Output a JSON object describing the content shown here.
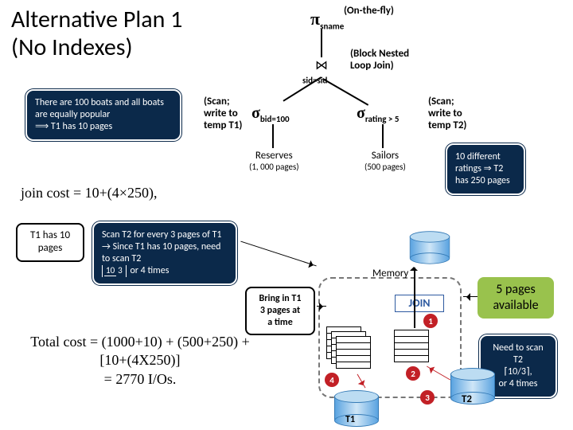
{
  "title": "Alternative Plan 1\n(No Indexes)",
  "tree": {
    "pi_sym": "π",
    "pi_sub": "sname",
    "pi_annot": "(On-the-fly)",
    "join_sub": "sid=sid",
    "join_annot": "(Block Nested\nLoop Join)",
    "left_sigma_sub": "bid=100",
    "left_sigma_annot": "(Scan;\nwrite to\ntemp T1)",
    "right_sigma_sub": "rating > 5",
    "right_sigma_annot": "(Scan;\nwrite to\ntemp T2)",
    "reserves": "Reserves",
    "reserves_pages": "(1, 000 pages)",
    "sailors": "Sailors",
    "sailors_pages": "(500 pages)"
  },
  "callouts": {
    "boats": "There are 100 boats and all boats are equally popular\n⟹ T1 has 10 pages",
    "ratings": "10 different ratings ⇒ T2 has 250 pages",
    "t1pages": "T1 has 10\npages",
    "scant2_lines": [
      "Scan T2 for every 3 pages of T1",
      "→ Since T1 has 10 pages, need to scan T2"
    ],
    "scant2_tail": " or 4 times",
    "needscan_head": "Need to scan T2",
    "needscan_mid": "⌈10/3⌉,",
    "needscan_tail": "or 4 times",
    "bring": "Bring in T1\n3 pages at\na time",
    "pages_avail": "5 pages\navailable"
  },
  "costs": {
    "join": "join cost = 10+(4×250),",
    "total": "Total cost = (1000+10) + (500+250) +\n[10+(4X250)]\n= 2770 I/Os."
  },
  "mem": {
    "label": "Memory",
    "join": "JOIN",
    "t1": "T1",
    "t2": "T2"
  },
  "nums": {
    "n1": "1",
    "n2": "2",
    "n3": "3",
    "n4": "4"
  },
  "frac": {
    "top": "10",
    "bot": "3"
  }
}
